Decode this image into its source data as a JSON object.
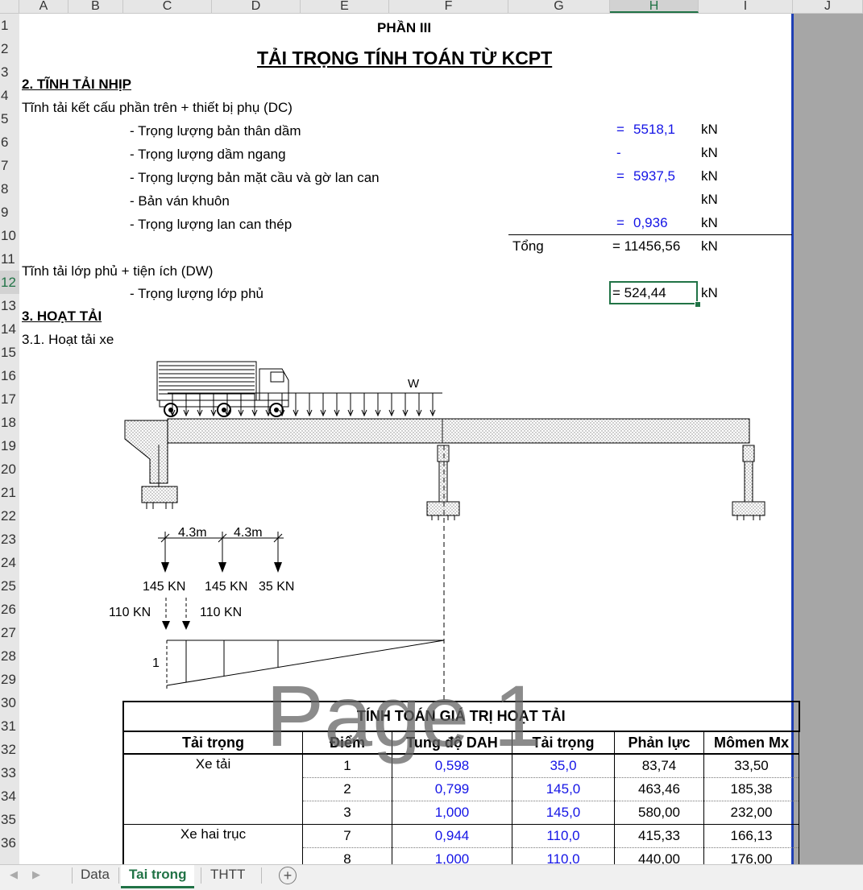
{
  "columns": [
    "A",
    "B",
    "C",
    "D",
    "E",
    "F",
    "G",
    "H",
    "I",
    "J"
  ],
  "rows": [
    "1",
    "2",
    "3",
    "4",
    "5",
    "6",
    "7",
    "8",
    "9",
    "10",
    "11",
    "12",
    "13",
    "14",
    "15",
    "16",
    "17",
    "18",
    "19",
    "20",
    "21",
    "22",
    "23",
    "24",
    "25",
    "26",
    "27",
    "28",
    "29",
    "30",
    "31",
    "32",
    "33",
    "34",
    "35",
    "36"
  ],
  "selected_column": "H",
  "selected_row": "12",
  "header": {
    "part": "PHẦN III",
    "title": "TẢI TRỌNG TÍNH TOÁN TỪ KCPT"
  },
  "static_load": {
    "heading": "2. TĨNH TẢI NHỊP",
    "dc_label": "Tĩnh tải kết cấu phần trên + thiết bị phụ (DC)",
    "items": [
      {
        "label": "- Trọng lượng bản thân dầm",
        "eq": "=",
        "value": "5518,1",
        "unit": "kN"
      },
      {
        "label": "- Trọng lượng dầm ngang",
        "eq": "",
        "value": "-",
        "unit": "kN"
      },
      {
        "label": "- Trọng lượng bản mặt cầu và gờ lan can",
        "eq": "=",
        "value": "5937,5",
        "unit": "kN"
      },
      {
        "label": "- Bản ván khuôn",
        "eq": "",
        "value": "",
        "unit": "kN"
      },
      {
        "label": "- Trọng lượng lan can thép",
        "eq": "=",
        "value": "0,936",
        "unit": "kN"
      }
    ],
    "total_label": "Tổng",
    "total_value": "= 11456,56",
    "total_unit": "kN",
    "dw_label": "Tĩnh tải lớp phủ + tiện ích (DW)",
    "dw_item_label": "- Trọng lượng lớp phủ",
    "dw_value": "= 524,44",
    "dw_unit": "kN"
  },
  "live_load": {
    "heading": "3. HOẠT TẢI",
    "sub_heading": "3.1. Hoạt tải xe"
  },
  "diagram": {
    "w_label": "W",
    "spacing1": "4.3m",
    "spacing2": "4.3m",
    "axle1": "145 KN",
    "axle2": "145 KN",
    "axle3": "35 KN",
    "tandem1": "110 KN",
    "tandem2": "110 KN",
    "ordinate": "1"
  },
  "watermark": "Page 1",
  "table": {
    "title": "TÍNH TOÁN GIÁ TRỊ HOẠT TẢI",
    "headers": [
      "Tải trọng",
      "Điểm",
      "Tung độ DAH",
      "Tải trọng",
      "Phản lực",
      "Mômen Mx"
    ],
    "groups": [
      {
        "name": "Xe tải",
        "rows": [
          {
            "point": "1",
            "dah": "0,598",
            "load": "35,0",
            "reaction": "83,74",
            "moment": "33,50"
          },
          {
            "point": "2",
            "dah": "0,799",
            "load": "145,0",
            "reaction": "463,46",
            "moment": "185,38"
          },
          {
            "point": "3",
            "dah": "1,000",
            "load": "145,0",
            "reaction": "580,00",
            "moment": "232,00"
          }
        ]
      },
      {
        "name": "Xe hai trục",
        "rows": [
          {
            "point": "7",
            "dah": "0,944",
            "load": "110,0",
            "reaction": "415,33",
            "moment": "166,13"
          },
          {
            "point": "8",
            "dah": "1,000",
            "load": "110,0",
            "reaction": "440,00",
            "moment": "176,00"
          }
        ]
      }
    ]
  },
  "sheets": {
    "tabs": [
      "Data",
      "Tai trong",
      "THTT"
    ],
    "active": "Tai trong",
    "add_label": "+"
  }
}
